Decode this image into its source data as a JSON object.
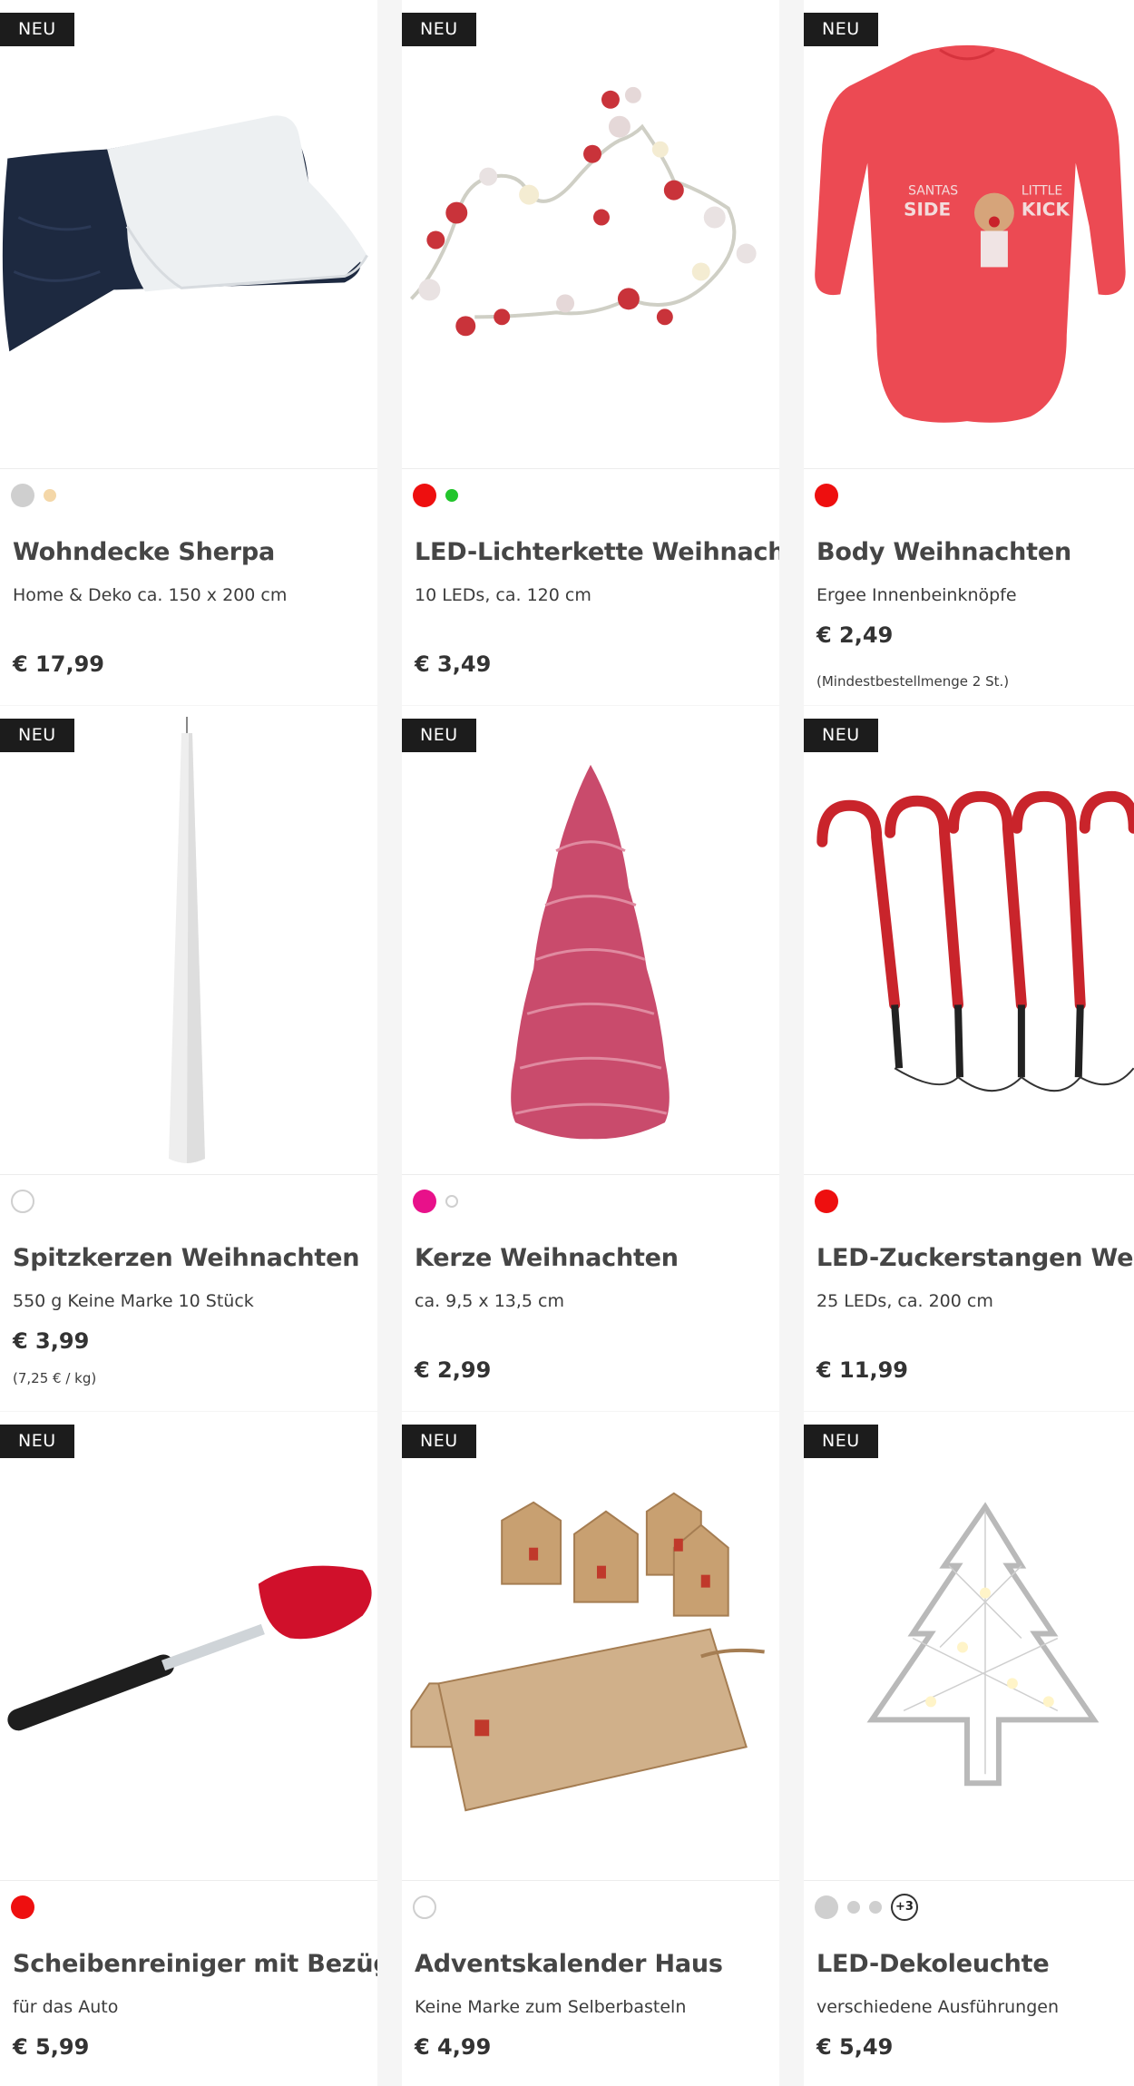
{
  "badge_label": "NEU",
  "products": [
    {
      "title": "Wohndecke Sherpa",
      "subtitle": "Home & Deko ca. 150 x 200 cm",
      "price": "€ 17,99",
      "swatches": [
        {
          "color": "#cfcfcf",
          "size": "big",
          "selected": true
        },
        {
          "color": "#f4d7a8",
          "size": "small",
          "selected": false
        }
      ]
    },
    {
      "title": "LED-Lichterkette Weihnachten",
      "subtitle": "10 LEDs, ca. 120 cm",
      "price": "€ 3,49",
      "swatches": [
        {
          "color": "#ee0f0f",
          "size": "big",
          "selected": true
        },
        {
          "color": "#22c52c",
          "size": "small",
          "selected": false
        }
      ]
    },
    {
      "title": "Body Weihnachten",
      "subtitle": "Ergee Innenbeinknöpfe",
      "price": "€ 2,49",
      "note": "(Mindestbestellmenge 2 St.)",
      "swatches": [
        {
          "color": "#ee0f0f",
          "size": "big",
          "selected": true
        }
      ]
    },
    {
      "title": "Spitzkerzen Weihnachten",
      "subtitle": "550 g Keine Marke 10 Stück",
      "price": "€ 3,99",
      "note": "(7,25 € / kg)",
      "swatches": [
        {
          "color": "#ffffff",
          "size": "big",
          "selected": true,
          "outline": true
        }
      ]
    },
    {
      "title": "Kerze Weihnachten",
      "subtitle": "ca. 9,5 x 13,5 cm",
      "price": "€ 2,99",
      "swatches": [
        {
          "color": "#e8118a",
          "size": "big",
          "selected": true
        },
        {
          "color": "#ffffff",
          "size": "small",
          "selected": false,
          "outline": true
        }
      ]
    },
    {
      "title": "LED-Zuckerstangen Weihnachten",
      "subtitle": "25 LEDs, ca. 200 cm",
      "price": "€ 11,99",
      "swatches": [
        {
          "color": "#ee0f0f",
          "size": "big",
          "selected": true
        }
      ]
    },
    {
      "title": "Scheibenreiniger mit Bezügen",
      "subtitle": "für das Auto",
      "price": "€ 5,99",
      "swatches": [
        {
          "color": "#ee0f0f",
          "size": "big",
          "selected": true
        }
      ]
    },
    {
      "title": "Adventskalender Haus",
      "subtitle": "Keine Marke zum Selberbasteln",
      "price": "€ 4,99",
      "swatches": [
        {
          "color": "#ffffff",
          "size": "big",
          "selected": true,
          "outline": true
        }
      ]
    },
    {
      "title": "LED-Dekoleuchte",
      "subtitle": "verschiedene Ausführungen",
      "price": "€ 5,49",
      "swatches": [
        {
          "color": "#cfcfcf",
          "size": "big",
          "selected": true
        },
        {
          "color": "#cfcfcf",
          "size": "small",
          "selected": false
        },
        {
          "color": "#cfcfcf",
          "size": "small",
          "selected": false
        }
      ],
      "more_swatches": "+3"
    }
  ]
}
